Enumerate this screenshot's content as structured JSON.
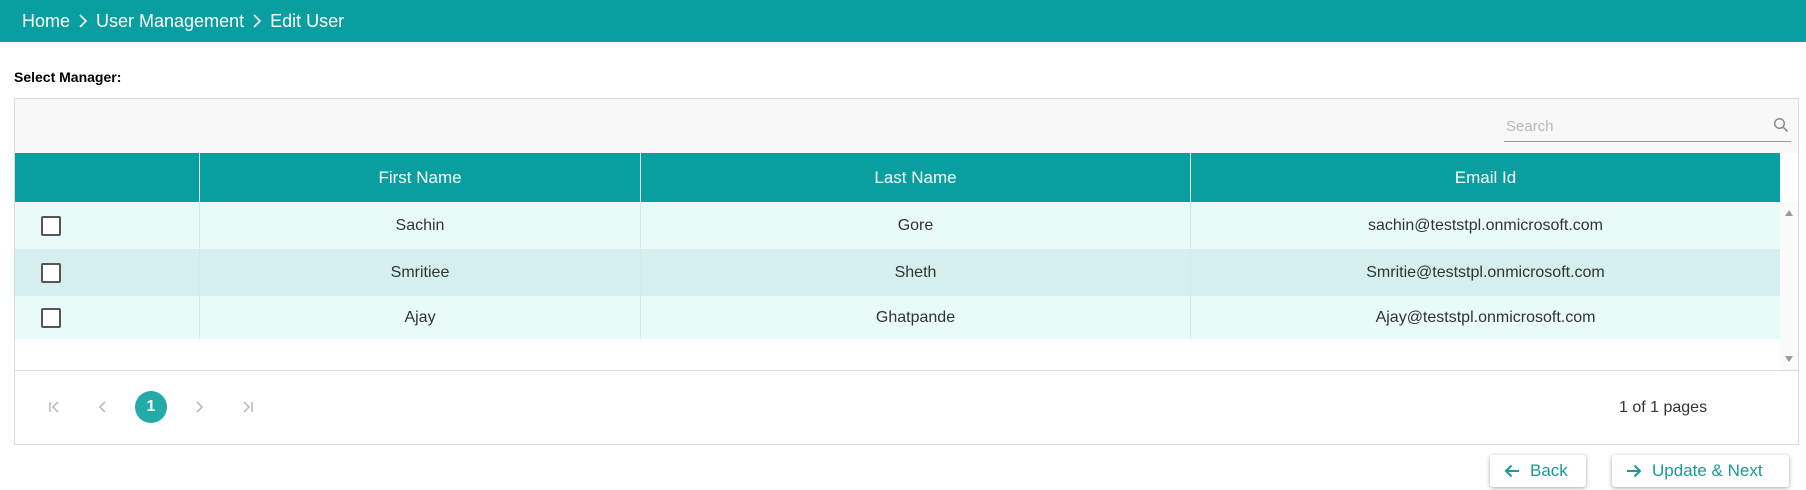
{
  "breadcrumb": [
    "Home",
    "User Management",
    "Edit User"
  ],
  "select_label": "Select Manager:",
  "search": {
    "placeholder": "Search",
    "value": ""
  },
  "columns": [
    "",
    "First Name",
    "Last Name",
    "Email Id"
  ],
  "rows": [
    {
      "first_name": "Sachin",
      "last_name": "Gore",
      "email": "sachin@teststpl.onmicrosoft.com",
      "checked": false
    },
    {
      "first_name": "Smritiee",
      "last_name": "Sheth",
      "email": "Smritie@teststpl.onmicrosoft.com",
      "checked": false
    },
    {
      "first_name": "Ajay",
      "last_name": "Ghatpande",
      "email": "Ajay@teststpl.onmicrosoft.com",
      "checked": false
    }
  ],
  "pager": {
    "current_page": "1",
    "info": "1 of 1 pages"
  },
  "buttons": {
    "back": "Back",
    "update_next": "Update & Next"
  },
  "colors": {
    "accent": "#099fa0",
    "row_light": "#e8fbf9",
    "row_selected": "#d4efed",
    "button_text": "#17999a"
  }
}
